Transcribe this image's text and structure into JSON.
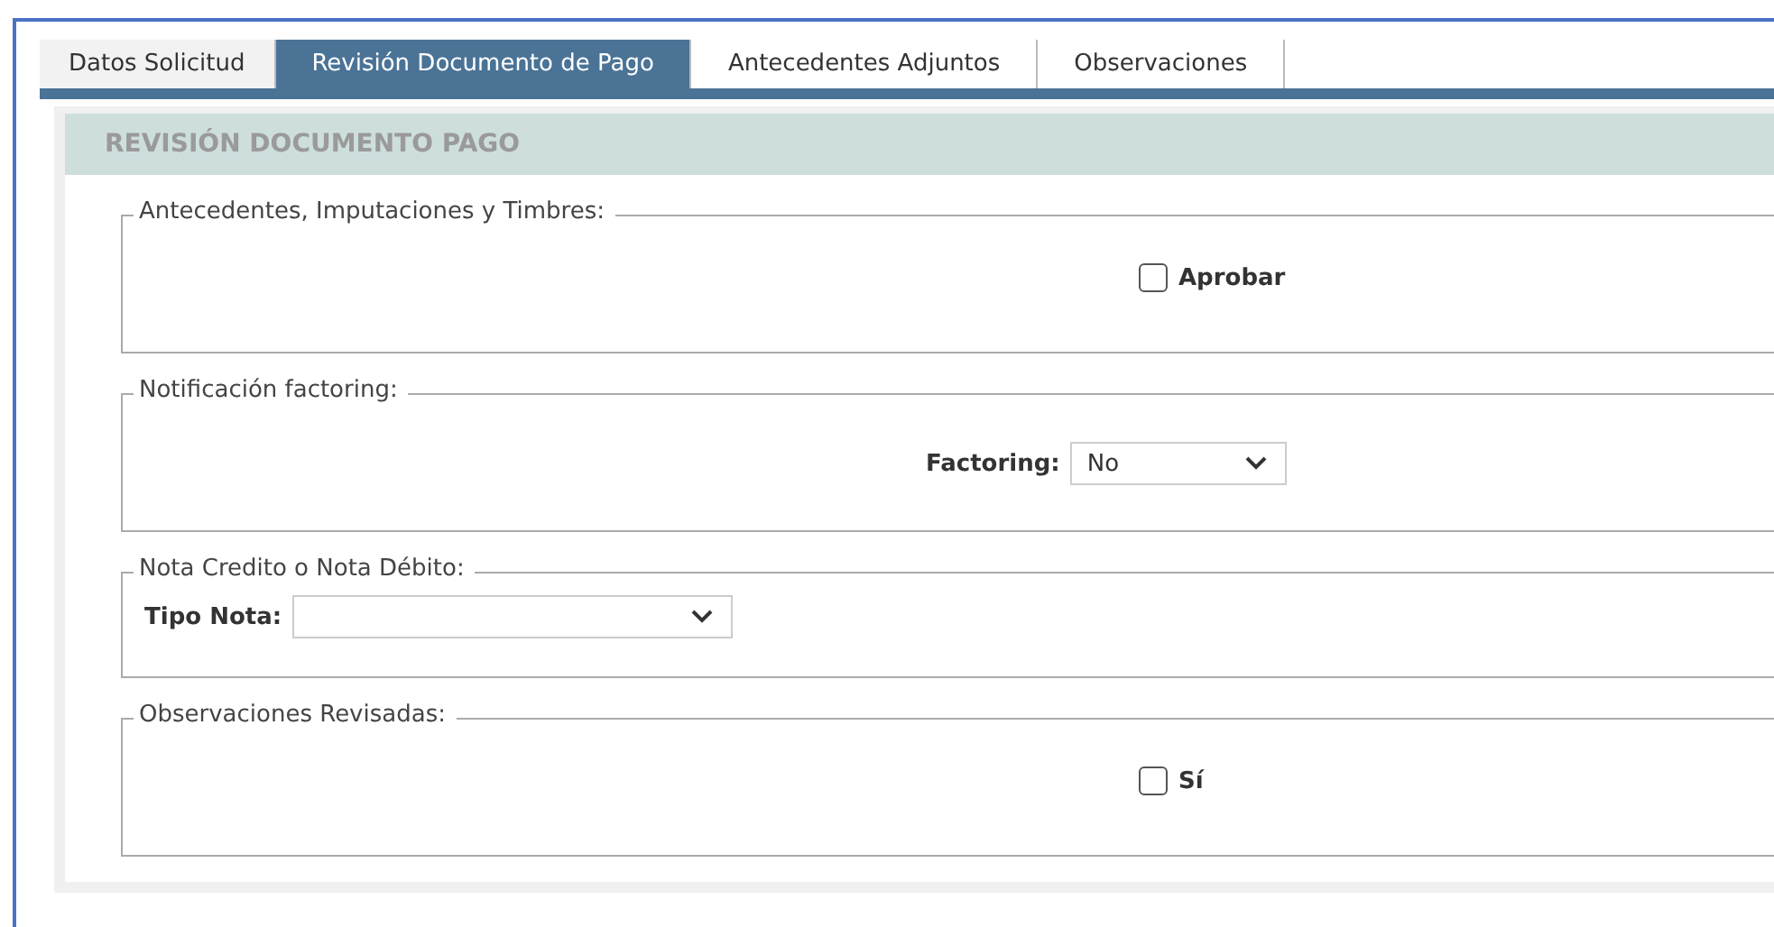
{
  "tabs": [
    {
      "label": "Datos Solicitud",
      "selected": false
    },
    {
      "label": "Revisión Documento de Pago",
      "selected": true
    },
    {
      "label": "Antecedentes Adjuntos",
      "selected": false
    },
    {
      "label": "Observaciones",
      "selected": false
    }
  ],
  "panel": {
    "title": "REVISIÓN DOCUMENTO PAGO",
    "sections": [
      {
        "legend": "Antecedentes, Imputaciones y Timbres:",
        "kind": "checkbox",
        "label": "Aprobar",
        "checked": false
      },
      {
        "legend": "Notificación factoring:",
        "kind": "select",
        "label": "Factoring:",
        "value": "No"
      },
      {
        "legend": "Nota Credito o Nota Débito:",
        "kind": "select-left",
        "label": "Tipo Nota:"
      },
      {
        "legend": "Observaciones Revisadas:",
        "kind": "checkbox",
        "label": "Sí",
        "checked": false
      }
    ]
  }
}
